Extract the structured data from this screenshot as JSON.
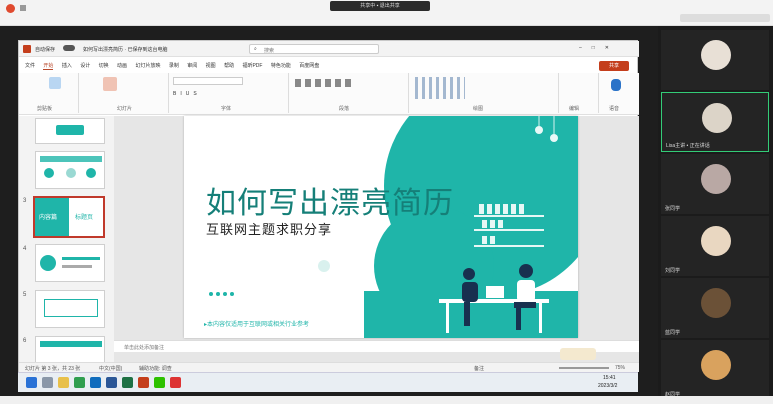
{
  "meeting": {
    "title_badge": "共享中 ▪ 退出共享"
  },
  "ppt": {
    "autosave": "自动保存",
    "doc_title": "如何写出漂亮简历 · 已保存到这台电脑",
    "search_placeholder": "搜索",
    "menu": [
      "文件",
      "开始",
      "插入",
      "设计",
      "切换",
      "动画",
      "幻灯片放映",
      "录制",
      "审阅",
      "视图",
      "帮助",
      "福昕PDF",
      "特色功能",
      "百度网盘"
    ],
    "active_menu": "开始",
    "share_label": "共享",
    "groups": [
      "剪贴板",
      "幻灯片",
      "字体",
      "段落",
      "绘图",
      "编辑",
      "语音"
    ],
    "notes_placeholder": "单击此处添加备注",
    "status": {
      "slide_info": "幻灯片 第 3 张，共 23 张",
      "lang": "中文(中国)",
      "accessibility": "辅助功能: 调查",
      "notes": "备注",
      "zoom": "75%"
    }
  },
  "thumbnails": [
    {
      "num": "",
      "label": ""
    },
    {
      "num": "",
      "label": ""
    },
    {
      "num": "3",
      "label_left": "内容篇",
      "label_right": "标题页"
    },
    {
      "num": "4",
      "label": ""
    },
    {
      "num": "5",
      "label": ""
    },
    {
      "num": "6",
      "label": ""
    }
  ],
  "slide": {
    "title": "如何写出漂亮简历",
    "subtitle": "互联网主题求职分享",
    "footnote": "▸本内容仅适用于互联网或相关行业参考"
  },
  "participants": [
    {
      "name": ""
    },
    {
      "name": "Lisa主讲 • 正在讲话"
    },
    {
      "name": "张同学"
    },
    {
      "name": "刘同学"
    },
    {
      "name": "蓝同学"
    },
    {
      "name": "赵同学"
    },
    {
      "name": ""
    }
  ],
  "taskbar": {
    "time": "15:41",
    "date": "2023/3/2",
    "apps": [
      "开始",
      "搜索",
      "文件",
      "浏览器",
      "邮件",
      "Word",
      "Excel",
      "PowerPoint",
      "微信",
      "会议"
    ]
  },
  "colors": {
    "teal": "#1fb5a9",
    "teal_dark": "#157f78",
    "ppt_red": "#b7472a",
    "bg_light": "#f6f6f6"
  }
}
